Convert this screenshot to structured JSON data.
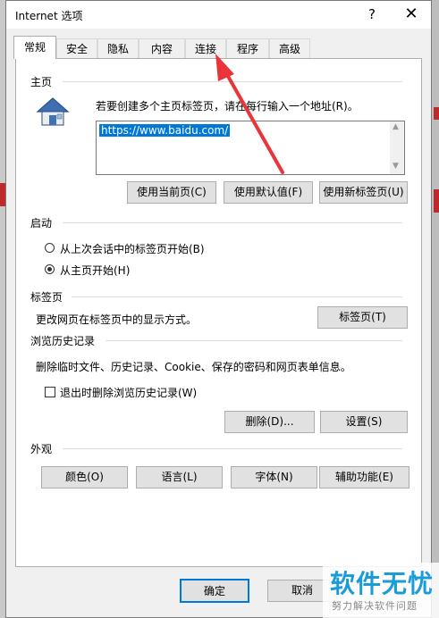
{
  "window": {
    "title": "Internet 选项",
    "help_glyph": "?",
    "close_glyph": "✕"
  },
  "tabs": [
    {
      "label": "常规"
    },
    {
      "label": "安全"
    },
    {
      "label": "隐私"
    },
    {
      "label": "内容"
    },
    {
      "label": "连接"
    },
    {
      "label": "程序"
    },
    {
      "label": "高级"
    }
  ],
  "home": {
    "section_label": "主页",
    "instruction": "若要创建多个主页标签页，请在每行输入一个地址(R)。",
    "url": "https://www.baidu.com/",
    "btn_current": "使用当前页(C)",
    "btn_default": "使用默认值(F)",
    "btn_newtab": "使用新标签页(U)"
  },
  "startup": {
    "section_label": "启动",
    "option_last_session": "从上次会话中的标签页开始(B)",
    "option_home": "从主页开始(H)",
    "selected": "home"
  },
  "tabs_section": {
    "section_label": "标签页",
    "description": "更改网页在标签页中的显示方式。",
    "button": "标签页(T)"
  },
  "history": {
    "section_label": "浏览历史记录",
    "description": "删除临时文件、历史记录、Cookie、保存的密码和网页表单信息。",
    "checkbox_label": "退出时删除浏览历史记录(W)",
    "checked": false,
    "btn_delete": "删除(D)...",
    "btn_settings": "设置(S)"
  },
  "appearance": {
    "section_label": "外观",
    "btn_colors": "颜色(O)",
    "btn_languages": "语言(L)",
    "btn_fonts": "字体(N)",
    "btn_accessibility": "辅助功能(E)"
  },
  "footer": {
    "ok": "确定",
    "cancel": "取消"
  },
  "watermark": {
    "main": "软件无忧",
    "sub": "努力解决软件问题"
  },
  "colors": {
    "annotation_arrow": "#e8343a",
    "selection": "#0078d7",
    "watermark": "#1a9cd8"
  }
}
